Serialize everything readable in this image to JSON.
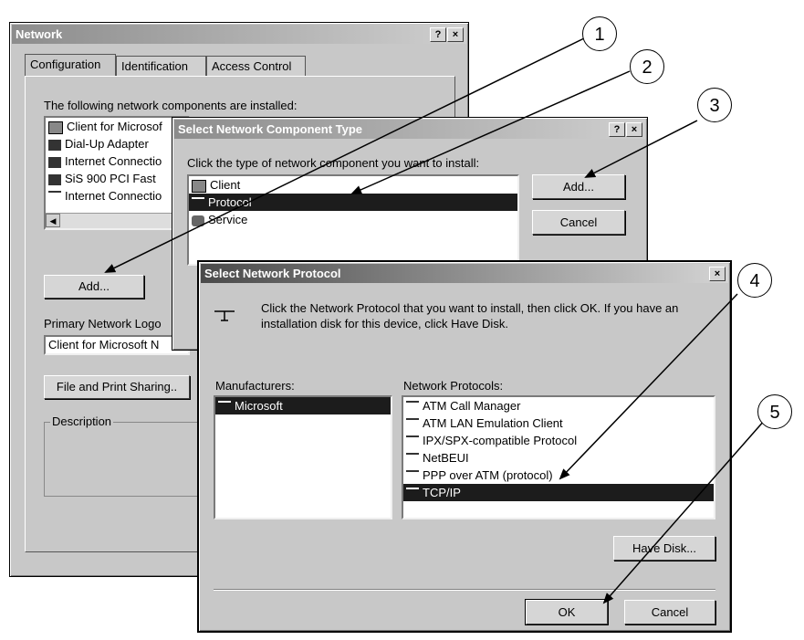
{
  "network_window": {
    "title": "Network",
    "help_btn": "?",
    "close_btn": "×",
    "tabs": [
      "Configuration",
      "Identification",
      "Access Control"
    ],
    "components_label": "The following network components are installed:",
    "components": [
      "Client for Microsof",
      "Dial-Up Adapter",
      "Internet Connectio",
      "SiS 900 PCI Fast",
      "Internet Connectio"
    ],
    "add_button": "Add...",
    "logon_label": "Primary Network Logo",
    "logon_value": "Client for Microsoft N",
    "file_print_button": "File and Print Sharing..",
    "description_label": "Description"
  },
  "component_type_window": {
    "title": "Select Network Component Type",
    "help_btn": "?",
    "close_btn": "×",
    "prompt": "Click the type of network component you want to install:",
    "items": [
      {
        "label": "Client",
        "icon": "client-icon",
        "selected": false
      },
      {
        "label": "Protocol",
        "icon": "protocol-icon",
        "selected": true
      },
      {
        "label": "Service",
        "icon": "service-icon",
        "selected": false
      }
    ],
    "add_button": "Add...",
    "cancel_button": "Cancel"
  },
  "protocol_window": {
    "title": "Select Network Protocol",
    "close_btn": "×",
    "instructions": "Click the Network Protocol that you want to install, then click OK. If you have an installation disk for this device, click Have Disk.",
    "manufacturers_label": "Manufacturers:",
    "manufacturers": [
      "Microsoft"
    ],
    "protocols_label": "Network Protocols:",
    "protocols": [
      {
        "label": "ATM Call Manager",
        "selected": false
      },
      {
        "label": "ATM LAN Emulation Client",
        "selected": false
      },
      {
        "label": "IPX/SPX-compatible Protocol",
        "selected": false
      },
      {
        "label": "NetBEUI",
        "selected": false
      },
      {
        "label": "PPP over ATM (protocol)",
        "selected": false
      },
      {
        "label": "TCP/IP",
        "selected": true
      }
    ],
    "have_disk_button": "Have Disk...",
    "ok_button": "OK",
    "cancel_button": "Cancel"
  },
  "callouts": [
    "1",
    "2",
    "3",
    "4",
    "5"
  ],
  "colors": {
    "selection": "#1c1c1c",
    "window_face": "#c8c8c8"
  }
}
